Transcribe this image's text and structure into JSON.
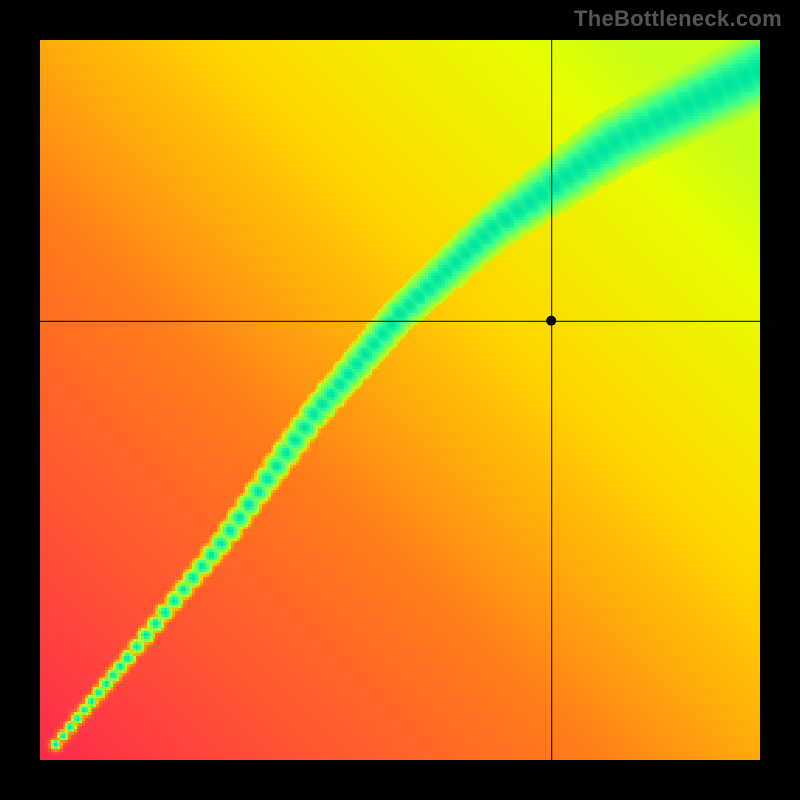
{
  "watermark": "TheBottleneck.com",
  "chart_data": {
    "type": "heatmap",
    "title": "",
    "xlabel": "",
    "ylabel": "",
    "xlim": [
      0,
      100
    ],
    "ylim": [
      0,
      100
    ],
    "resolution": 256,
    "color_stops": [
      {
        "t": 0.0,
        "color": "#ff2a4f"
      },
      {
        "t": 0.35,
        "color": "#ff7a1a"
      },
      {
        "t": 0.55,
        "color": "#ffd400"
      },
      {
        "t": 0.72,
        "color": "#e8ff00"
      },
      {
        "t": 0.86,
        "color": "#9bff3a"
      },
      {
        "t": 0.94,
        "color": "#3aff90"
      },
      {
        "t": 1.0,
        "color": "#00e6a0"
      }
    ],
    "ridge": {
      "curve_control_points": [
        {
          "x": 2,
          "y": 2
        },
        {
          "x": 12,
          "y": 14
        },
        {
          "x": 25,
          "y": 30
        },
        {
          "x": 38,
          "y": 48
        },
        {
          "x": 50,
          "y": 62
        },
        {
          "x": 63,
          "y": 74
        },
        {
          "x": 80,
          "y": 86
        },
        {
          "x": 100,
          "y": 96
        }
      ],
      "half_width_profile": [
        {
          "x": 0,
          "w": 1.0
        },
        {
          "x": 20,
          "w": 2.0
        },
        {
          "x": 40,
          "w": 3.5
        },
        {
          "x": 60,
          "w": 5.2
        },
        {
          "x": 80,
          "w": 7.6
        },
        {
          "x": 100,
          "w": 9.2
        }
      ],
      "core_sharpness": 1.7
    },
    "crosshair": {
      "x": 71,
      "y": 61
    },
    "marker": {
      "x": 71,
      "y": 61,
      "radius_px": 5
    }
  }
}
